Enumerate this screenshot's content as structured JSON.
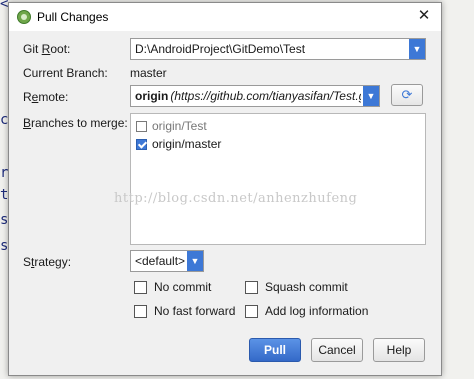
{
  "background": {
    "code_fragments": [
      "<",
      "cl",
      "r",
      "te",
      "su",
      "se"
    ]
  },
  "dialog": {
    "title": "Pull Changes",
    "git_root": {
      "label_pre": "Git ",
      "label_u": "R",
      "label_post": "oot:",
      "value": "D:\\AndroidProject\\GitDemo\\Test"
    },
    "current_branch": {
      "label": "Current Branch:",
      "value": "master"
    },
    "remote": {
      "label_pre": "R",
      "label_u": "e",
      "label_post": "mote:",
      "name": "origin",
      "url": "(https://github.com/tianyasifan/Test.git)"
    },
    "branches": {
      "label_u": "B",
      "label_post": "ranches to merge:",
      "items": [
        {
          "name": "origin/Test",
          "checked": false
        },
        {
          "name": "origin/master",
          "checked": true
        }
      ]
    },
    "watermark": "http://blog.csdn.net/anhenzhufeng",
    "strategy": {
      "label_pre": "S",
      "label_u": "t",
      "label_post": "rategy:",
      "value": "<default>"
    },
    "options": {
      "no_commit": "No commit",
      "squash_commit": "Squash commit",
      "no_fast_forward": "No fast forward",
      "add_log": "Add log information"
    },
    "buttons": {
      "pull": "Pull",
      "cancel": "Cancel",
      "help": "Help"
    }
  },
  "colors": {
    "accent": "#3d78d6",
    "primary_button": "#3469c8"
  }
}
